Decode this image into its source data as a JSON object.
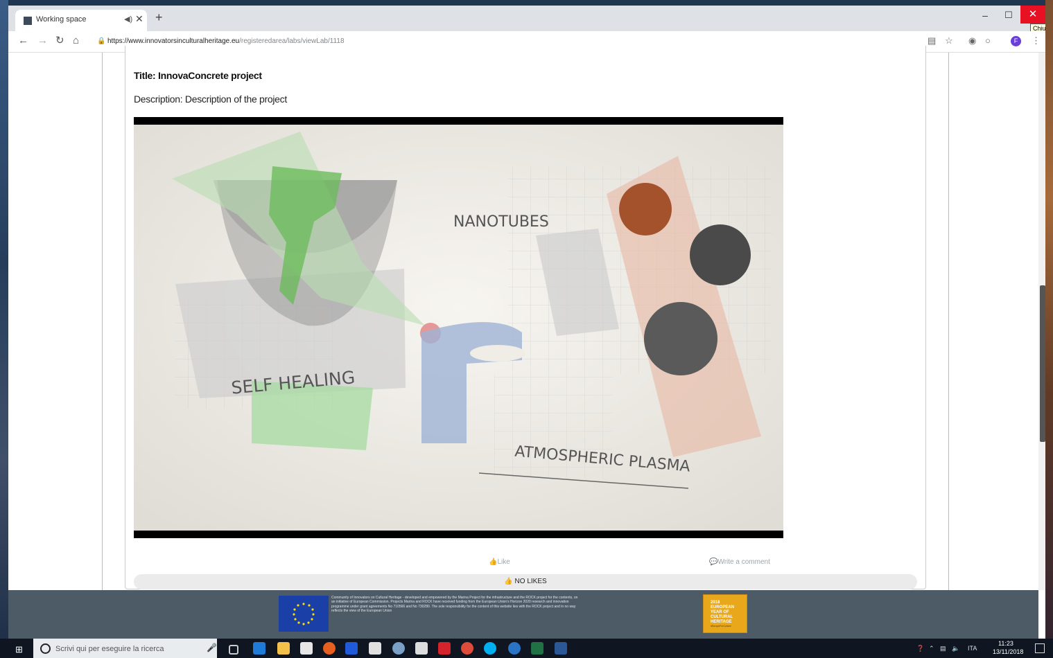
{
  "browser": {
    "tab_title": "Working space",
    "tab_audio_icon": "speaker-icon",
    "tab_close": "✕",
    "new_tab": "+",
    "url_domain": "https://www.innovatorsinculturalheritage.eu",
    "url_path": "/registeredarea/labs/viewLab/1118",
    "tooltip": "Chiudi",
    "profile_initial": "F"
  },
  "page": {
    "title": "Title: InnovaConcrete project",
    "description": "Description: Description of the project",
    "video_labels": {
      "nanotubes": "NANOTUBES",
      "self_healing": "SELF HEALING",
      "plasma": "ATMOSPHERIC PLASMA"
    },
    "like_label": "Like",
    "comment_label": "Write a comment",
    "likes_count": "NO LIKES"
  },
  "footer": {
    "text": "Community of Innovators on Cultural Heritage - developed and empowered by the Marina Project for the infrastructure and the ROCK project for the contents, on an initiative of European Commission. Projects Marina and ROCK have received funding from the European Union's Horizon 2020 research and innovation programme under grant agreements No 710566 and No 730280. The sole responsibility for the content of this website lies with the ROCK project and in no way reflects the view of the European Union",
    "eych_title": "2018 EUROPEAN YEAR OF CULTURAL HERITAGE",
    "eych_tag": "#EuropeForCulture"
  },
  "taskbar": {
    "search_placeholder": "Scrivi qui per eseguire la ricerca",
    "language": "ITA",
    "time": "11:23",
    "date": "13/11/2018"
  },
  "colors": {
    "accent_close": "#e81123",
    "footer_bg": "#4d5b66",
    "eych": "#e9a81b"
  }
}
